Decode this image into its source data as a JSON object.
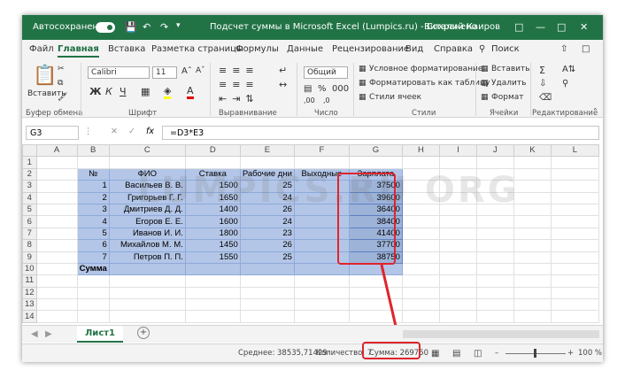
{
  "titlebar": {
    "autosave": "Автосохранение",
    "toggle_state": "Вкл.",
    "doc_title": "Подсчет суммы в Microsoft Excel (Lumpics.ru)  -  Сохранено",
    "user": "Виталий Каиров"
  },
  "menu": {
    "tabs": [
      "Файл",
      "Главная",
      "Вставка",
      "Разметка страницы",
      "Формулы",
      "Данные",
      "Рецензирование",
      "Вид",
      "Справка",
      "Поиск"
    ]
  },
  "ribbon": {
    "clipboard": {
      "paste": "Вставить",
      "group": "Буфер обмена"
    },
    "font": {
      "name": "Calibri",
      "size": "11",
      "group": "Шрифт",
      "bold": "Ж",
      "italic": "К",
      "underline": "Ч"
    },
    "align": {
      "group": "Выравнивание"
    },
    "number": {
      "format": "Общий",
      "group": "Число"
    },
    "styles": {
      "cond": "Условное форматирование",
      "table": "Форматировать как таблицу",
      "cells": "Стили ячеек",
      "group": "Стили"
    },
    "cells": {
      "insert": "Вставить",
      "delete": "Удалить",
      "format": "Формат",
      "group": "Ячейки"
    },
    "editing": {
      "group": "Редактирование"
    }
  },
  "formula_bar": {
    "name_box": "G3",
    "fx": "fx",
    "formula": "=D3*E3"
  },
  "columns": [
    "A",
    "B",
    "C",
    "D",
    "E",
    "F",
    "G",
    "H",
    "I",
    "J",
    "K",
    "L"
  ],
  "rows": [
    "1",
    "2",
    "3",
    "4",
    "5",
    "6",
    "7",
    "8",
    "9",
    "10",
    "11",
    "12",
    "13",
    "14"
  ],
  "table": {
    "headers": [
      "№",
      "ФИО",
      "Ставка",
      "Рабочие дни",
      "Выходные",
      "Зарплата"
    ],
    "data": [
      [
        "1",
        "Васильев В. В.",
        "1500",
        "25",
        "",
        "37500"
      ],
      [
        "2",
        "Григорьев Г. Г.",
        "1650",
        "24",
        "",
        "39600"
      ],
      [
        "3",
        "Дмитриев Д. Д.",
        "1400",
        "26",
        "",
        "36400"
      ],
      [
        "4",
        "Егоров Е. Е.",
        "1600",
        "24",
        "",
        "38400"
      ],
      [
        "5",
        "Иванов И. И.",
        "1800",
        "23",
        "",
        "41400"
      ],
      [
        "6",
        "Михайлов М. М.",
        "1450",
        "26",
        "",
        "37700"
      ],
      [
        "7",
        "Петров П. П.",
        "1550",
        "25",
        "",
        "38750"
      ]
    ],
    "total_label": "Сумма"
  },
  "watermark": "LUMPICS.RU ORG",
  "sheet": {
    "tab": "Лист1",
    "add": "+"
  },
  "status": {
    "average": "Среднее: 38535,71429",
    "count": "Количество: 7",
    "sum": "Сумма: 269750",
    "zoom": "100 %"
  },
  "colors": {
    "excel_green": "#217346",
    "table_fill": "#b4c6e7",
    "selection": "#9db3d8",
    "highlight": "#e0242c"
  }
}
